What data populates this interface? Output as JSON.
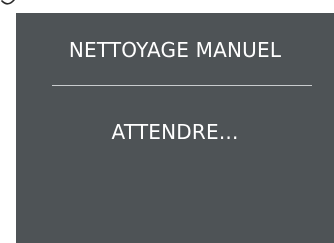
{
  "screen": {
    "title": "NETTOYAGE MANUEL",
    "status": "ATTENDRE..."
  },
  "colors": {
    "screen_background": "#4e5356",
    "text": "#ffffff",
    "divider": "#c9ccce"
  }
}
